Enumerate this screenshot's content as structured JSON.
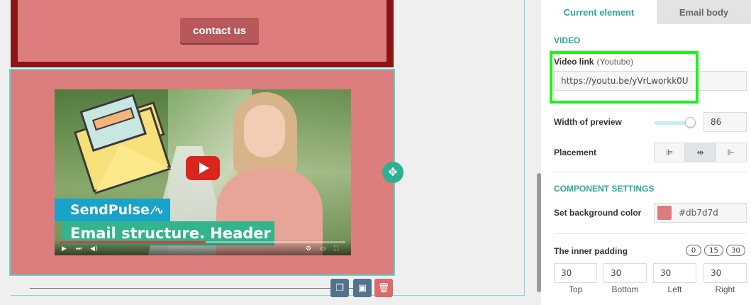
{
  "canvas": {
    "contact_button": "contact us",
    "video": {
      "brand_text": "SendPulse",
      "title_text": "Email structure. Header",
      "progress_percent": 51
    },
    "block_color": "#db7d7d",
    "border_color": "#8b1515",
    "selection_color": "#5cd6d0"
  },
  "panel": {
    "tabs": {
      "current": "Current element",
      "body": "Email body"
    },
    "video_section": {
      "title": "VIDEO",
      "link_label": "Video link",
      "link_hint": "(Youtube)",
      "link_value": "https://youtu.be/yVrLworkk0U",
      "width_label": "Width of preview",
      "width_value": "86",
      "width_fraction": 0.86,
      "placement_label": "Placement",
      "placement_options": [
        "left",
        "center",
        "right"
      ],
      "placement_selected": "center"
    },
    "component_section": {
      "title": "COMPONENT SETTINGS",
      "bg_label": "Set background color",
      "bg_value": "#db7d7d",
      "padding_label": "The inner padding",
      "padding_presets": [
        "0",
        "15",
        "30"
      ],
      "padding": {
        "top": "30",
        "bottom": "30",
        "left": "30",
        "right": "30",
        "top_label": "Top",
        "bottom_label": "Bottom",
        "left_label": "Left",
        "right_label": "Right"
      }
    },
    "accent_color": "#2aa89b",
    "highlight_color": "#1df31d"
  },
  "icons": {
    "move": "move-arrows-icon",
    "copy": "copy-icon",
    "save": "save-icon",
    "delete": "trash-icon",
    "play": "play-icon"
  }
}
